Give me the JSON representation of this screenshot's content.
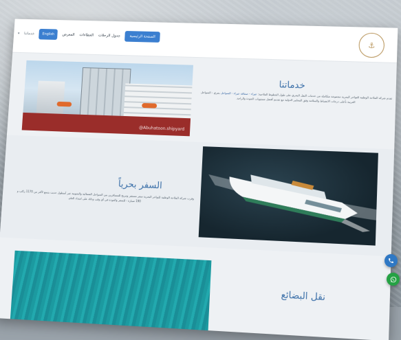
{
  "nav": {
    "dropdown_label": "خدماتنا",
    "language_button": "English",
    "links": {
      "gallery": "المعرض",
      "offers": "العطاءات",
      "schedule": "جدول الرحلات",
      "home": "الصفحة الرئيسية"
    }
  },
  "services": {
    "title": "خدماتنا",
    "paragraph_line1": "تقدم شركة الملاحة الوطنية للبواخر البحرية مجموعة متكاملة من خدمات النقل البحري على طول الخطوط الملاحية:",
    "paragraph_highlight1": "عيراء - صفاقة",
    "paragraph_line2": "بحري - السواحل العربية بأعلى درجات الانضباط والسلامة وفق المعايير الدولية مع تقديم أفضل مستويات الجودة والراحة.",
    "paragraph_highlight2": "عيراء - السواحل",
    "image_watermark": "@Abuhatoon.shipyard"
  },
  "sea_travel": {
    "title": "السفر بحرياً",
    "paragraph_line1": "وفرت شركة الملاحة الوطنية للبواخر البحرية سفر مستقر ومريح للمسافرين بين السواحل الشمالية والجنوبية عبر أسطول حديث يتسع لأكثر من 1170 راكب و 190 سيارة - للسفر والعودة في أي وقت",
    "paragraph_line2": "وذلك على امتداد العام."
  },
  "goods_transport": {
    "title": "نقل البضائع"
  },
  "colors": {
    "accent": "#3b7fd0",
    "title": "#3a6fa8",
    "whatsapp": "#25a244",
    "phone": "#2f78c4"
  }
}
